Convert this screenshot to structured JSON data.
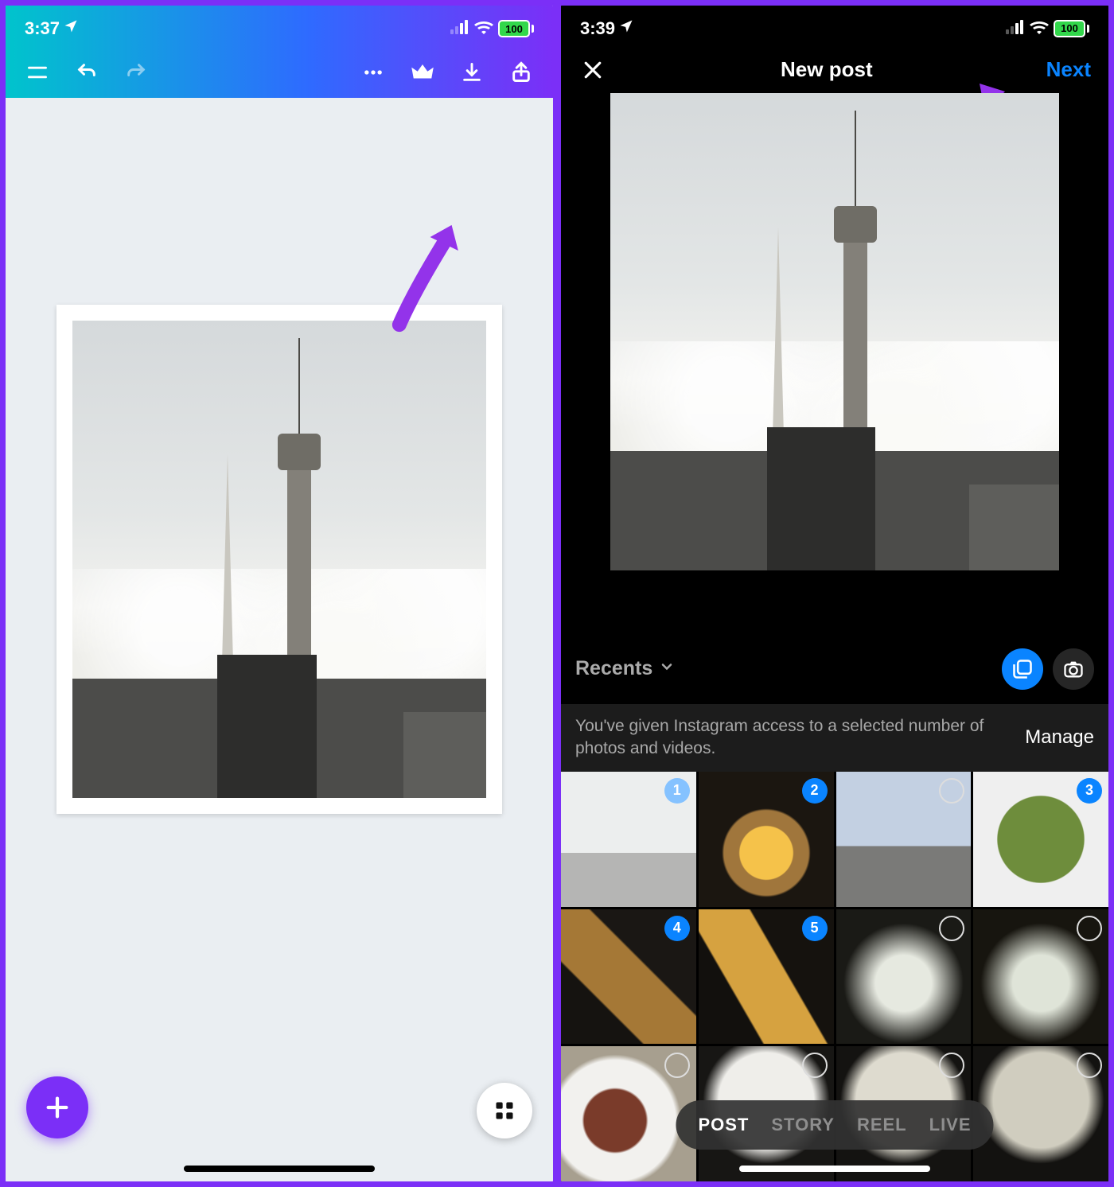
{
  "left": {
    "status": {
      "time": "3:37",
      "battery": "100"
    }
  },
  "right": {
    "status": {
      "time": "3:39",
      "battery": "100"
    },
    "header": {
      "title": "New post",
      "next": "Next"
    },
    "album": "Recents",
    "access": {
      "text": "You've given Instagram access to a selected number of photos and videos.",
      "manage": "Manage"
    },
    "grid": [
      {
        "cls": "c-tower",
        "selected": true,
        "badge": "1"
      },
      {
        "cls": "c-drink",
        "badge": "2"
      },
      {
        "cls": "c-city",
        "badge": ""
      },
      {
        "cls": "c-pasta",
        "badge": "3"
      },
      {
        "cls": "c-bread",
        "badge": "4"
      },
      {
        "cls": "c-fries",
        "badge": "5"
      },
      {
        "cls": "c-drink2",
        "badge": ""
      },
      {
        "cls": "c-drink3",
        "badge": ""
      },
      {
        "cls": "c-donut",
        "badge": ""
      },
      {
        "cls": "c-plate1",
        "badge": ""
      },
      {
        "cls": "c-plate2",
        "badge": ""
      },
      {
        "cls": "c-plate3",
        "badge": ""
      }
    ],
    "modes": {
      "items": [
        "POST",
        "STORY",
        "REEL",
        "LIVE"
      ],
      "active": 0
    }
  }
}
